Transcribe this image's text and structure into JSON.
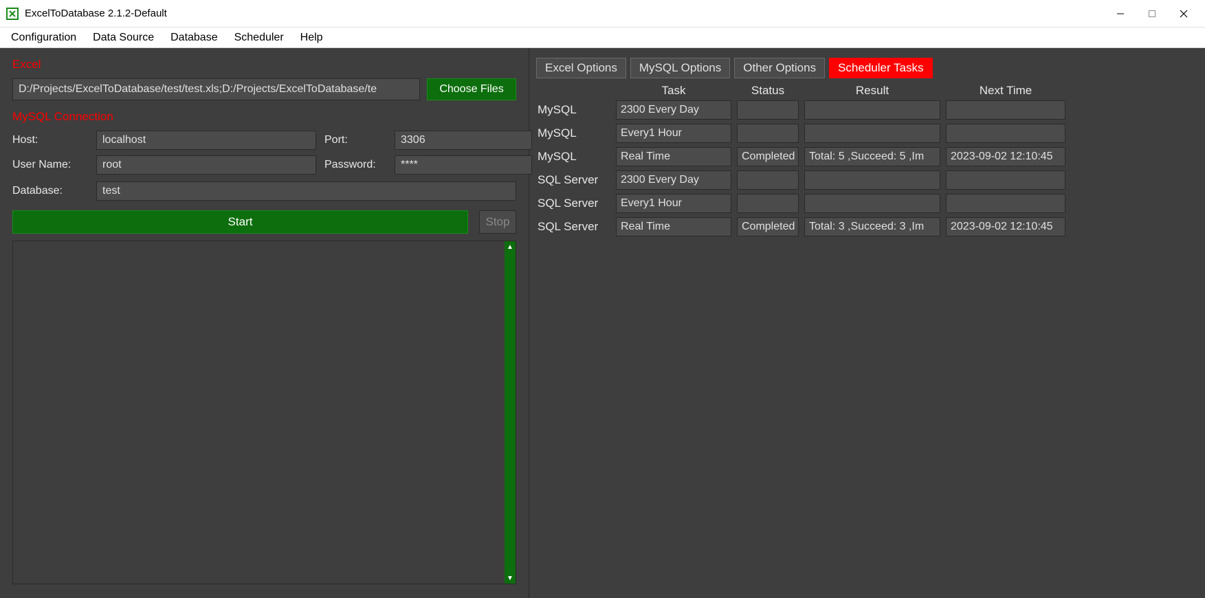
{
  "window": {
    "title": "ExcelToDatabase 2.1.2-Default"
  },
  "menu": {
    "items": [
      "Configuration",
      "Data Source",
      "Database",
      "Scheduler",
      "Help"
    ]
  },
  "left": {
    "excel_label": "Excel",
    "file_path": "D:/Projects/ExcelToDatabase/test/test.xls;D:/Projects/ExcelToDatabase/te",
    "choose_files": "Choose Files",
    "mysql_label": "MySQL Connection",
    "host_label": "Host:",
    "host_value": "localhost",
    "port_label": "Port:",
    "port_value": "3306",
    "user_label": "User Name:",
    "user_value": "root",
    "pass_label": "Password:",
    "pass_value": "****",
    "db_label": "Database:",
    "db_value": "test",
    "start": "Start",
    "stop": "Stop"
  },
  "tabs": {
    "items": [
      "Excel Options",
      "MySQL Options",
      "Other Options",
      "Scheduler Tasks"
    ],
    "active": 3
  },
  "table": {
    "headers": [
      "Task",
      "Status",
      "Result",
      "Next Time"
    ],
    "rows": [
      {
        "label": "MySQL",
        "task": "2300 Every Day",
        "status": "",
        "result": "",
        "next": ""
      },
      {
        "label": "MySQL",
        "task": "Every1 Hour",
        "status": "",
        "result": "",
        "next": ""
      },
      {
        "label": "MySQL",
        "task": "Real Time",
        "status": "Completed",
        "result": "Total: 5 ,Succeed: 5 ,Im",
        "next": "2023-09-02 12:10:45"
      },
      {
        "label": "SQL Server",
        "task": "2300 Every Day",
        "status": "",
        "result": "",
        "next": ""
      },
      {
        "label": "SQL Server",
        "task": "Every1 Hour",
        "status": "",
        "result": "",
        "next": ""
      },
      {
        "label": "SQL Server",
        "task": "Real Time",
        "status": "Completed",
        "result": "Total: 3 ,Succeed: 3 ,Im",
        "next": "2023-09-02 12:10:45"
      }
    ]
  }
}
